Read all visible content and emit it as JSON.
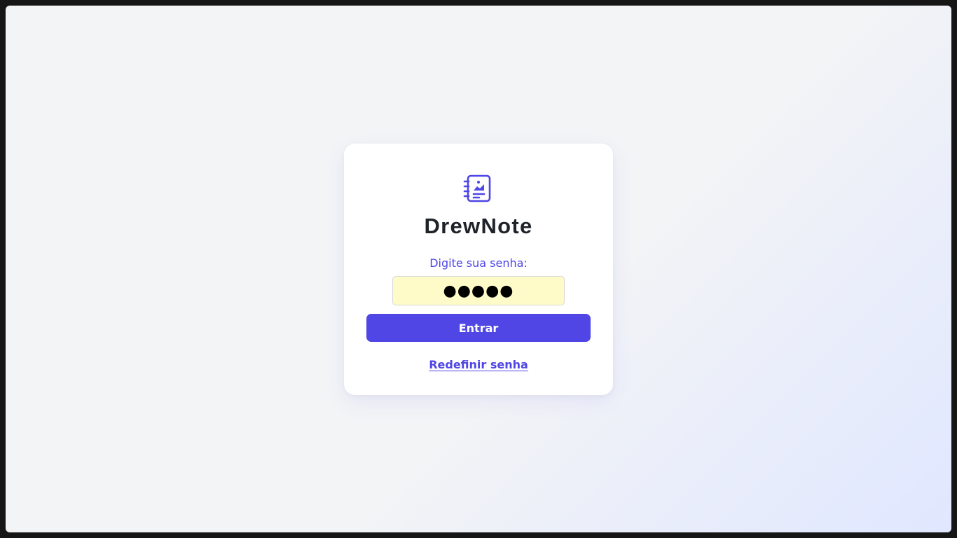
{
  "login": {
    "app_name": "DrewNote",
    "logo_icon": "notebook-chart-icon",
    "password_label": "Digite sua senha:",
    "password_value": "●●●●●",
    "submit_label": "Entrar",
    "reset_link": "Redefinir senha"
  },
  "colors": {
    "accent": "#4f46e5",
    "title": "#1f2229",
    "input_bg": "#fefbc9",
    "card_bg": "#ffffff",
    "page_bg_start": "#f3f4f6",
    "page_bg_end": "#e0e7ff"
  }
}
